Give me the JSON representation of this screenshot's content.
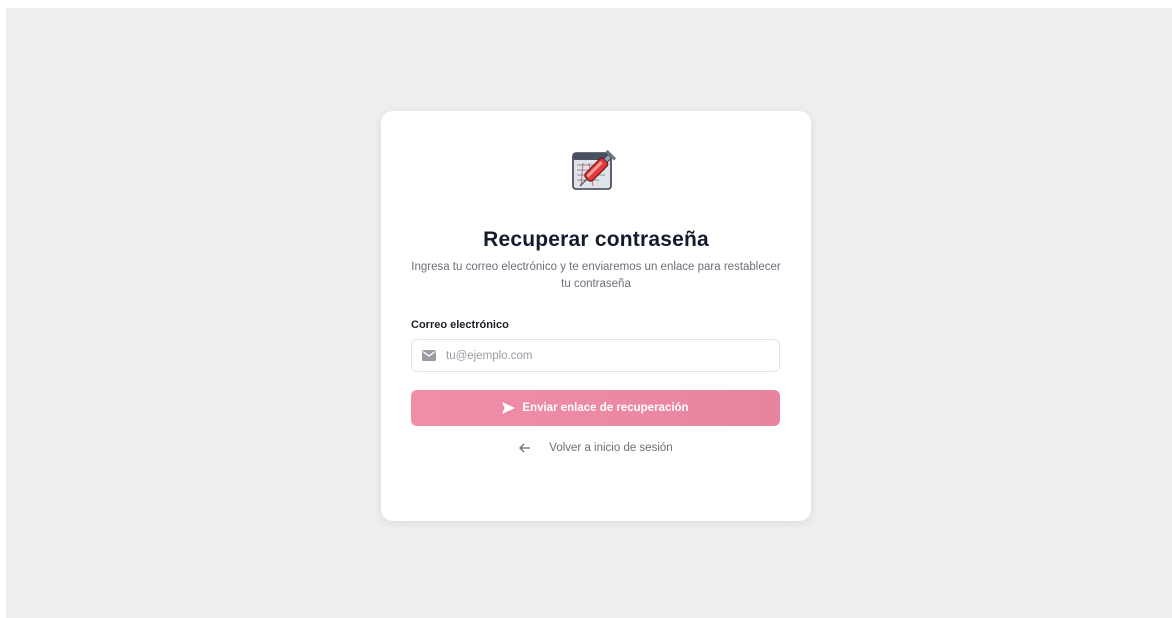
{
  "card": {
    "title": "Recuperar contraseña",
    "subtitle": "Ingresa tu correo electrónico y te enviaremos un enlace para restablecer tu contraseña",
    "logo_icon": "syringe-app-logo-icon"
  },
  "form": {
    "email_label": "Correo electrónico",
    "email_placeholder": "tu@ejemplo.com",
    "email_value": "",
    "email_icon": "envelope-icon",
    "submit_label": "Enviar enlace de recuperación",
    "submit_icon": "send-icon"
  },
  "footer": {
    "back_label": "Volver a inicio de sesión",
    "back_icon": "arrow-left-icon"
  },
  "colors": {
    "background": "#efeeef",
    "card": "#ffffff",
    "title": "#151a2d",
    "accent": "#ee8ba5",
    "muted_text": "#6b6f78"
  }
}
